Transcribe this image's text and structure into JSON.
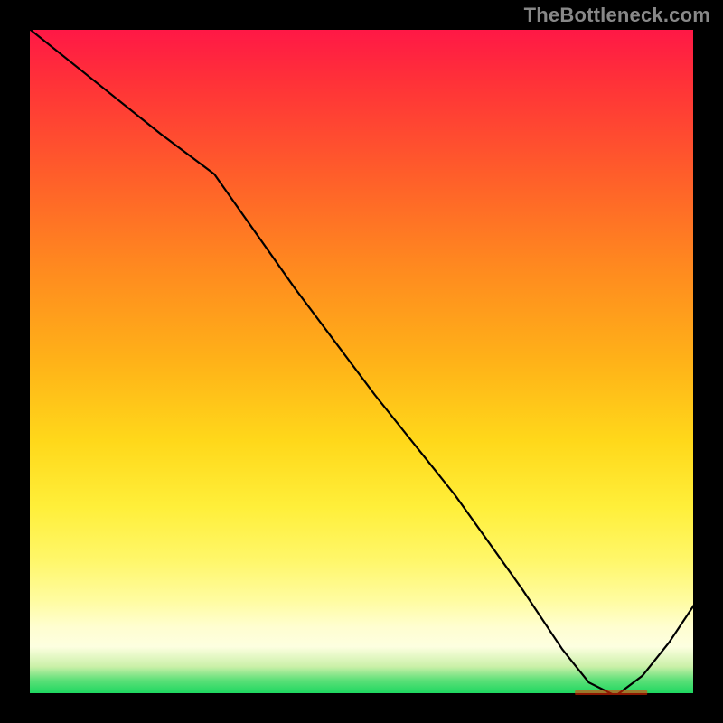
{
  "attribution": "TheBottleneck.com",
  "min_marker_label": "",
  "chart_data": {
    "type": "line",
    "title": "",
    "xlabel": "",
    "ylabel": "",
    "xlim": [
      0,
      100
    ],
    "ylim": [
      0,
      100
    ],
    "grid": false,
    "series": [
      {
        "name": "curve",
        "x": [
          0,
          10,
          20,
          28,
          40,
          52,
          64,
          74,
          80,
          84,
          88,
          92,
          96,
          100
        ],
        "y": [
          100,
          92,
          84,
          78,
          61,
          45,
          30,
          16,
          7,
          2,
          0,
          3,
          8,
          14
        ]
      }
    ],
    "minimum_at_x": 88,
    "minimum_at_y": 0,
    "gradient_stops": [
      {
        "pos": 0.0,
        "color": "#ff1846"
      },
      {
        "pos": 0.5,
        "color": "#ffd81a"
      },
      {
        "pos": 0.9,
        "color": "#fffed0"
      },
      {
        "pos": 1.0,
        "color": "#1ed760"
      }
    ]
  }
}
